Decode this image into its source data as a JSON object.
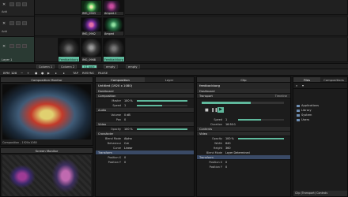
{
  "grid": {
    "layers": [
      {
        "add_label": "Add",
        "clips": [
          {
            "caption": "IMG_0963"
          },
          {
            "caption": "Amped-1"
          }
        ]
      },
      {
        "add_label": "Add",
        "clips": [
          {
            "caption": "IMG_0962"
          },
          {
            "caption": "Amped"
          }
        ]
      },
      {
        "label": "Layer 1",
        "clips": [
          {
            "caption": "Feedbackborg"
          },
          {
            "caption": "IMG_0968"
          },
          {
            "caption": "Feedbackborg"
          }
        ]
      }
    ],
    "columns": [
      "Column 1",
      "Column 2",
      "V1 pole",
      "empty",
      "empty"
    ]
  },
  "transport": {
    "bpm_label": "BPM",
    "bpm": "120",
    "tap": "TAP",
    "resync": "RESYNC",
    "pause": "PAUSE"
  },
  "composition_monitor": {
    "title": "Composition Monitor",
    "caption": "Composition - 1920x1080"
  },
  "screen_monitor": {
    "title": "Screen Monitor"
  },
  "composition_panel": {
    "tabs": [
      "Composition",
      "Layer"
    ],
    "name": "Untitled (1920 x 1080)",
    "dashboard": "Dashboard",
    "composition_section": "Composition",
    "master_label": "Master",
    "master_value": "100 %",
    "master_level": 1.0,
    "speed_label": "Speed",
    "speed_value": "1",
    "speed_level": 0.5,
    "audio_section": "Audio",
    "volume_label": "Volume",
    "volume_value": "0 dB",
    "pan_label": "Pan",
    "pan_value": "0",
    "video_section": "Video",
    "opacity_label": "Opacity",
    "opacity_value": "100 %",
    "opacity_level": 1.0,
    "crossfader_section": "Crossfader",
    "blend_label": "Blend Mode",
    "blend_value": "Alpha",
    "behaviour_label": "Behaviour",
    "behaviour_value": "Cut",
    "curve_label": "Curve",
    "curve_value": "Linear",
    "transform_section": "Transform",
    "posx_label": "Position X",
    "posx_value": "0",
    "posy_label": "Position Y",
    "posy_value": "0"
  },
  "clip_panel": {
    "title": "Clip",
    "name": "feedbackborg",
    "dashboard": "Dashboard",
    "transport_section": "Transport",
    "timeline_label": "Timeline",
    "speed_label": "Speed",
    "speed_value": "1",
    "duration_label": "Duration",
    "duration_value": "16:50:1",
    "contents_section": "Contents",
    "video_section": "Video",
    "opacity_label": "Opacity",
    "opacity_value": "100 %",
    "opacity_level": 1.0,
    "width_label": "Width",
    "width_value": "640",
    "height_label": "Height",
    "height_value": "360",
    "blend_label": "Blend Mode",
    "blend_value": "Layer Determined",
    "transform_section": "Transform",
    "posx_label": "Position X",
    "posx_value": "0",
    "posy_label": "Position Y",
    "posy_value": "0"
  },
  "files_panel": {
    "tabs": [
      "Files",
      "Compositions"
    ],
    "tree": [
      "Applications",
      "Library",
      "System",
      "Users"
    ],
    "footer": "Clip (Transport) Controls"
  },
  "colors": {
    "accent": "#5fb89c",
    "panel": "#1c1c1c",
    "header": "#2e2e2e"
  }
}
